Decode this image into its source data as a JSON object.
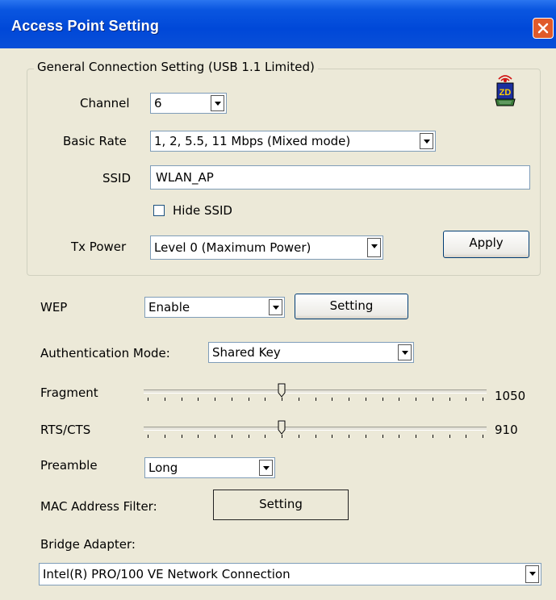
{
  "window": {
    "title": "Access Point Setting"
  },
  "general": {
    "legend": "General Connection Setting (USB 1.1 Limited)",
    "channel_label": "Channel",
    "channel_value": "6",
    "basic_rate_label": "Basic Rate",
    "basic_rate_value": "1, 2, 5.5, 11 Mbps (Mixed mode)",
    "ssid_label": "SSID",
    "ssid_value": "WLAN_AP",
    "hide_ssid_label": "Hide SSID",
    "hide_ssid_checked": false,
    "tx_power_label": "Tx Power",
    "tx_power_value": "Level 0 (Maximum Power)",
    "apply_label": "Apply",
    "logo_text": "ZD"
  },
  "wep": {
    "label": "WEP",
    "value": "Enable",
    "setting_label": "Setting"
  },
  "auth": {
    "label": "Authentication Mode:",
    "value": "Shared Key"
  },
  "fragment": {
    "label": "Fragment",
    "value": "1050",
    "position": 0.4
  },
  "rts": {
    "label": "RTS/CTS",
    "value": "910",
    "position": 0.4
  },
  "preamble": {
    "label": "Preamble",
    "value": "Long"
  },
  "mac_filter": {
    "label": "MAC Address Filter:",
    "setting_label": "Setting"
  },
  "bridge": {
    "label": "Bridge Adapter:",
    "value": "Intel(R) PRO/100 VE Network Connection"
  },
  "colors": {
    "titlebar": "#0a56e0",
    "window_bg": "#ece9d8",
    "close_button": "#e05a2a"
  }
}
